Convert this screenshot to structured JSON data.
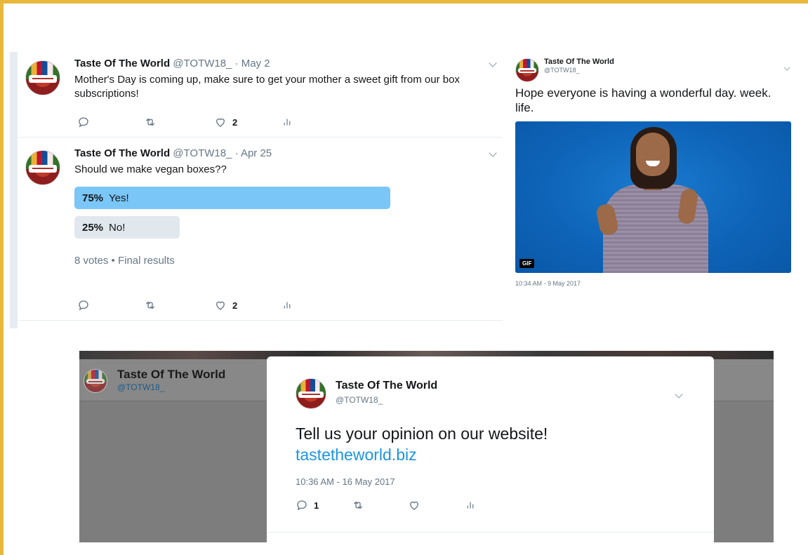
{
  "account": {
    "name": "Taste Of The World",
    "handle": "@TOTW18_"
  },
  "timeline": {
    "tweets": [
      {
        "name": "Taste Of The World",
        "handle": "@TOTW18_",
        "separator": "·",
        "date": "May 2",
        "text": "Mother's Day is coming up, make sure to get your mother a sweet gift from our box subscriptions!",
        "likes": "2"
      },
      {
        "name": "Taste Of The World",
        "handle": "@TOTW18_",
        "separator": "·",
        "date": "Apr 25",
        "text": "Should we make vegan boxes??",
        "poll": {
          "choices": [
            {
              "percent": "75%",
              "label": "Yes!",
              "fraction": 0.75
            },
            {
              "percent": "25%",
              "label": "No!",
              "fraction": 0.25
            }
          ],
          "meta": "8 votes • Final results"
        },
        "likes": "2"
      }
    ]
  },
  "gif_tweet": {
    "name": "Taste Of The World",
    "handle": "@TOTW18_",
    "text": "Hope everyone is having a wonderful day. week. life.",
    "badge": "GIF",
    "timestamp": "10:34 AM - 9 May 2017"
  },
  "modal_tweet": {
    "background_name": "Taste Of The World",
    "background_handle": "@TOTW18_",
    "name": "Taste Of The World",
    "handle": "@TOTW18_",
    "text": "Tell us your opinion on our website!",
    "link": "tastetheworld.biz",
    "timestamp": "10:36 AM - 16 May 2017",
    "replies": "1"
  },
  "colors": {
    "frame": "#e8b83b",
    "link": "#1b95e0",
    "poll_winner": "#7ac6f6",
    "poll_other": "#e1e8ed",
    "muted": "#657786"
  },
  "icons": [
    "reply-icon",
    "retweet-icon",
    "like-icon",
    "analytics-icon",
    "chevron-down-icon"
  ]
}
